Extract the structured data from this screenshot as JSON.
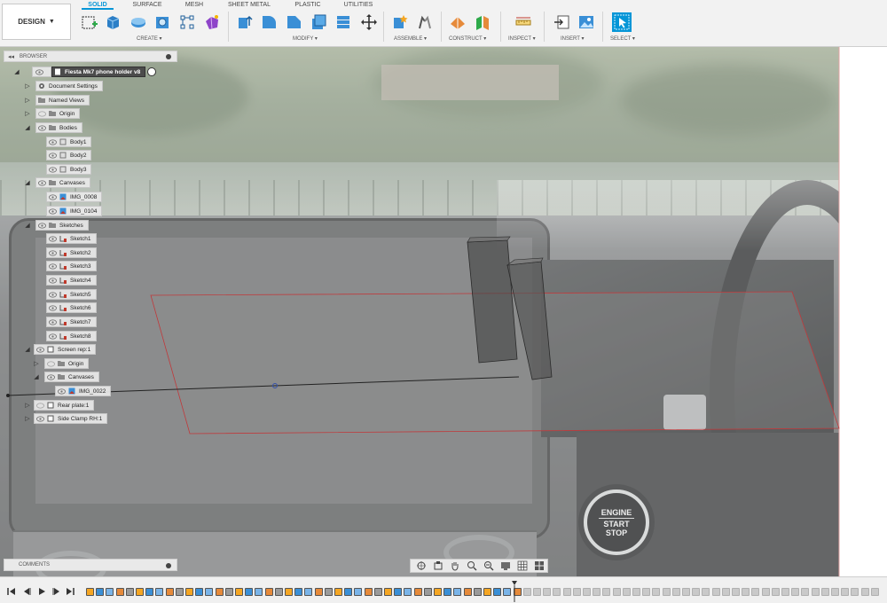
{
  "toolbar": {
    "workspace_label": "DESIGN",
    "tabs": [
      "SOLID",
      "SURFACE",
      "MESH",
      "SHEET METAL",
      "PLASTIC",
      "UTILITIES"
    ],
    "active_tab": "SOLID",
    "groups": {
      "create": "CREATE ▾",
      "modify": "MODIFY ▾",
      "assemble": "ASSEMBLE ▾",
      "construct": "CONSTRUCT ▾",
      "inspect": "INSPECT ▾",
      "insert": "INSERT ▾",
      "select": "SELECT ▾"
    }
  },
  "browser": {
    "header": "BROWSER",
    "tree": {
      "root": "Fiesta Mk7 phone holder v8",
      "document_settings": "Document Settings",
      "named_views": "Named Views",
      "origin": "Origin",
      "bodies": "Bodies",
      "body_items": [
        "Body1",
        "Body2",
        "Body3"
      ],
      "canvases": "Canvases",
      "canvas_items": [
        "IMG_0008",
        "IMG_0104"
      ],
      "sketches": "Sketches",
      "sketch_items": [
        "Sketch1",
        "Sketch2",
        "Sketch3",
        "Sketch4",
        "Sketch5",
        "Sketch6",
        "Sketch7",
        "Sketch8"
      ],
      "screen_rep": "Screen rep:1",
      "screen_rep_origin": "Origin",
      "screen_rep_canvases": "Canvases",
      "screen_rep_canvas_item": "IMG_0022",
      "rear_plate": "Rear plate:1",
      "side_clamp": "Side Clamp RH:1"
    }
  },
  "comments": {
    "label": "COMMENTS"
  },
  "scene": {
    "start_button": {
      "line1": "ENGINE",
      "line2": "START",
      "line3": "STOP"
    }
  },
  "colors": {
    "accent": "#0696d7",
    "sketch_plane_edge": "#c0393b",
    "toolbar_bg": "#f2f2f2"
  }
}
